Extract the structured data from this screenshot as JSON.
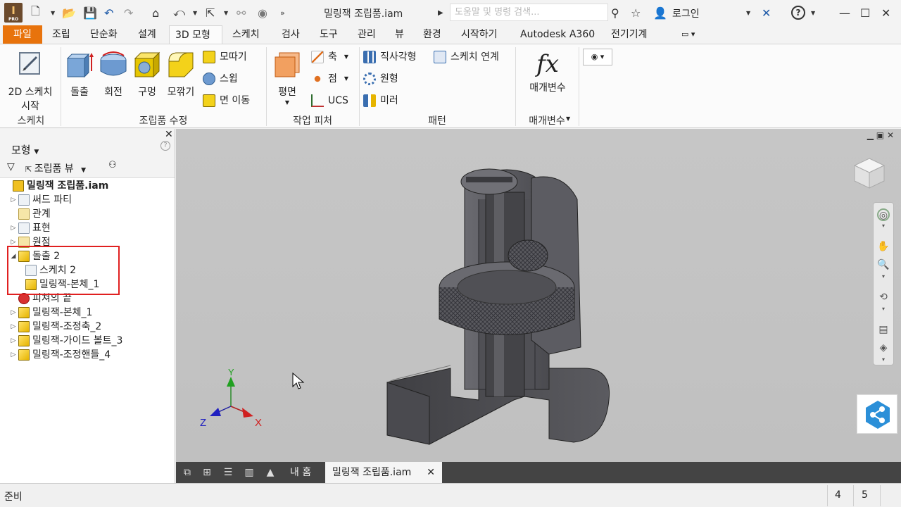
{
  "titlebar": {
    "doc_title": "밀링잭 조립품.iam",
    "search_placeholder": "도움말 및 명령 검색...",
    "login_label": "로그인",
    "logo_text": "I",
    "logo_sub": "PRO"
  },
  "tabs": [
    {
      "label": "파일"
    },
    {
      "label": "조립"
    },
    {
      "label": "단순화"
    },
    {
      "label": "설계"
    },
    {
      "label": "3D 모형"
    },
    {
      "label": "스케치"
    },
    {
      "label": "검사"
    },
    {
      "label": "도구"
    },
    {
      "label": "관리"
    },
    {
      "label": "뷰"
    },
    {
      "label": "환경"
    },
    {
      "label": "시작하기"
    },
    {
      "label": "Autodesk A360"
    },
    {
      "label": "전기기계"
    }
  ],
  "ribbon": {
    "sketch": {
      "start_label": "2D 스케치\n시작",
      "start_line1": "2D 스케치",
      "start_line2": "시작",
      "group": "스케치"
    },
    "modify": {
      "extrude": "돌출",
      "revolve": "회전",
      "hole": "구멍",
      "fillet": "모깎기",
      "chamfer": "모따기",
      "sweep": "스윕",
      "move_face": "면 이동",
      "group": "조립품 수정"
    },
    "work": {
      "plane": "평면",
      "axis": "축",
      "point": "점",
      "ucs": "UCS",
      "group": "작업 피처"
    },
    "pattern": {
      "rect": "직사각형",
      "sketch_link": "스케치 연계",
      "circular": "원형",
      "mirror": "미러",
      "group": "패턴"
    },
    "params": {
      "fx": "fx",
      "label": "매개변수",
      "group": "매개변수"
    }
  },
  "browser": {
    "title": "모형",
    "view_label": "조립품 뷰",
    "close": "✕",
    "help": "?",
    "tree": [
      {
        "label": "밀링잭 조립품.iam"
      },
      {
        "label": "써드 파티"
      },
      {
        "label": "관계"
      },
      {
        "label": "표현"
      },
      {
        "label": "원점"
      },
      {
        "label": "돌출 2"
      },
      {
        "label": "스케치 2"
      },
      {
        "label": "밀링잭-본체_1"
      },
      {
        "label": "피쳐의 끝"
      },
      {
        "label": "밀링잭-본체_1"
      },
      {
        "label": "밀링잭-조정축_2"
      },
      {
        "label": "밀링잭-가이드 볼트_3"
      },
      {
        "label": "밀링잭-조정핸들_4"
      }
    ]
  },
  "viewport": {
    "axes": {
      "x": "X",
      "y": "Y",
      "z": "Z"
    }
  },
  "doctabs": {
    "home": "내 홈",
    "doc": "밀링잭 조립품.iam",
    "close": "✕"
  },
  "status": {
    "text": "준비",
    "num1": "4",
    "num2": "5"
  },
  "colors": {
    "file_tab": "#e8730c",
    "viewport_bg": "#c4c4c4",
    "highlight": "#e02020"
  }
}
